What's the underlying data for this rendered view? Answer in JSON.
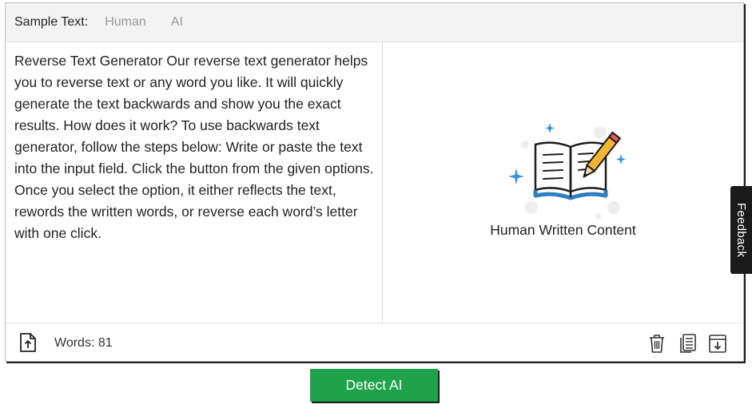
{
  "sample": {
    "label": "Sample Text:",
    "options": [
      "Human",
      "AI"
    ]
  },
  "input": {
    "text": "Reverse Text Generator Our reverse text generator helps you to reverse text or any word you like. It will quickly generate the text backwards and show you the exact results. How does it work? To use backwards text generator, follow the steps below: Write or paste the text into the input field. Click the button from the given options. Once you select the option, it either reflects the text, rewords the written words, or reverse each word’s letter with one click."
  },
  "result": {
    "label": "Human Written Content",
    "icon": "book-pencil-icon"
  },
  "footer": {
    "word_count": "Words: 81",
    "icons": [
      "upload-icon",
      "trash-icon",
      "copy-icon",
      "download-icon"
    ]
  },
  "feedback": {
    "label": "Feedback"
  },
  "detect_button": {
    "label": "Detect AI"
  },
  "colors": {
    "accent_green": "#1fa34a",
    "book_blue": "#2e7fc1",
    "sparkle_blue": "#3a8fd9",
    "pencil_yellow": "#f2b632"
  }
}
